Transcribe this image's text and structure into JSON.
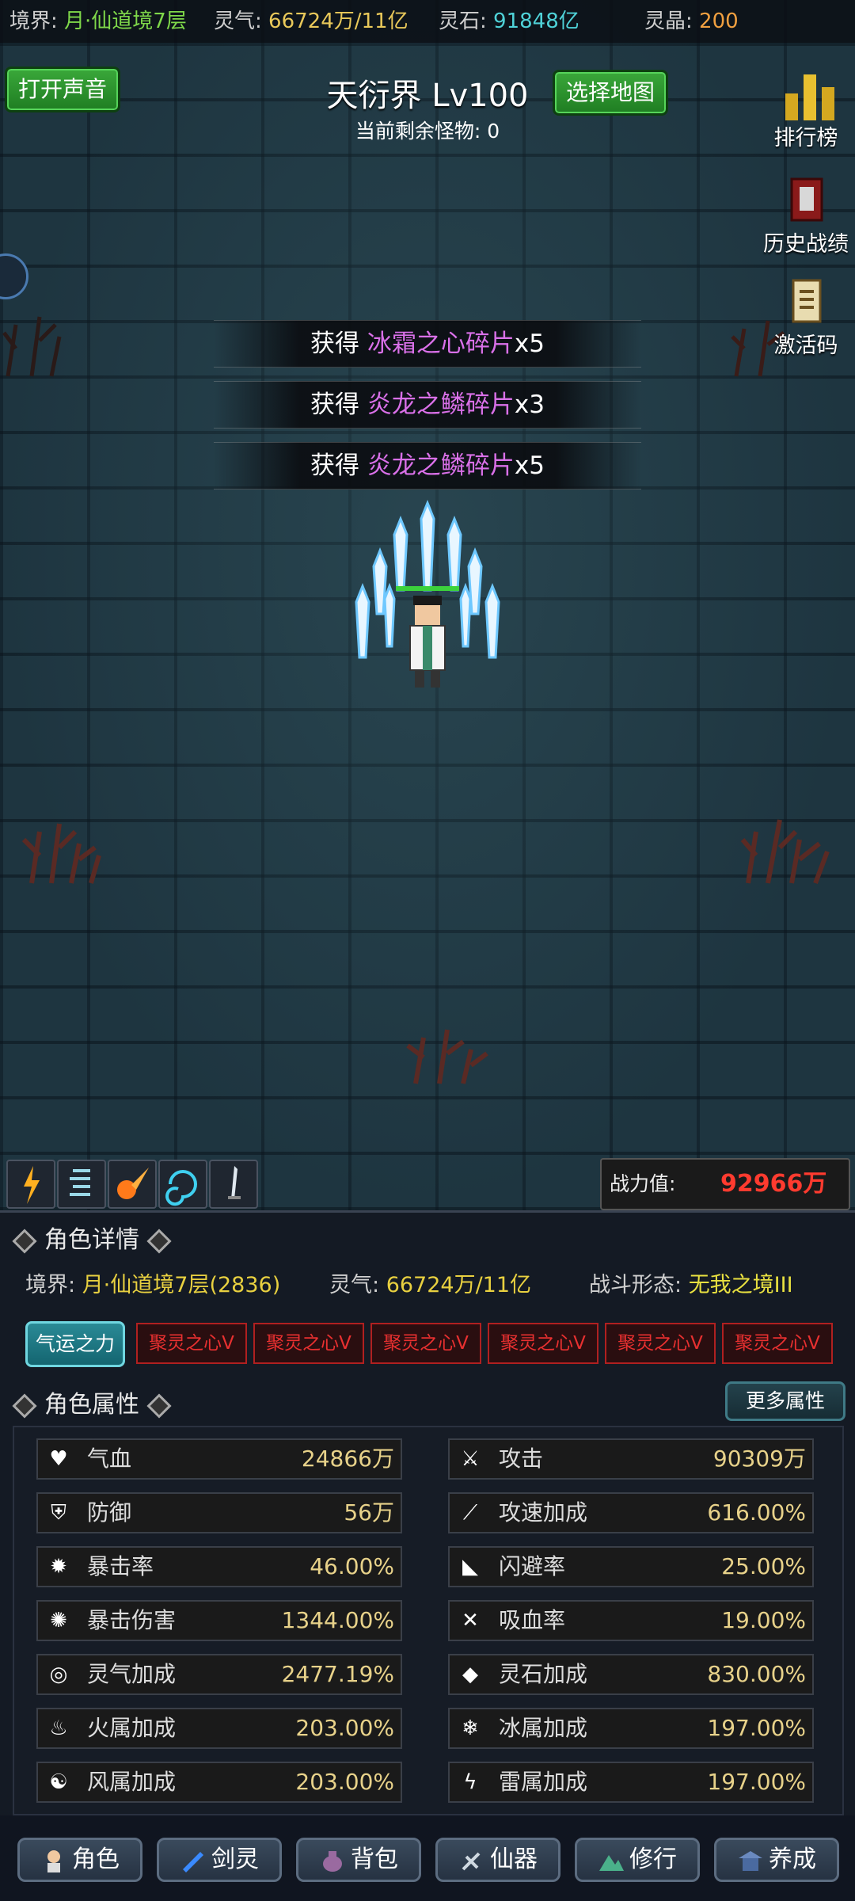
{
  "topbar": {
    "realm_label": "境界: ",
    "realm_value": "月·仙道境7层",
    "qi_label": "灵气: ",
    "qi_value": "66724万/11亿",
    "stone_label": "灵石: ",
    "stone_value": "91848亿",
    "crystal_label": "灵晶: ",
    "crystal_value": "200"
  },
  "controls": {
    "sound_button": "打开声音",
    "map_button": "选择地图"
  },
  "map": {
    "title": "天衍界 Lv100",
    "remaining_label": "当前剩余怪物: ",
    "remaining_value": "0"
  },
  "side_menu": [
    {
      "label": "排行榜",
      "icon": "bar-chart-icon"
    },
    {
      "label": "历史战绩",
      "icon": "book-icon"
    },
    {
      "label": "激活码",
      "icon": "scroll-icon"
    }
  ],
  "loot": [
    {
      "prefix": "获得 ",
      "item": "冰霜之心碎片",
      "qty": "x5"
    },
    {
      "prefix": "获得 ",
      "item": "炎龙之鳞碎片",
      "qty": "x3"
    },
    {
      "prefix": "获得 ",
      "item": "炎龙之鳞碎片",
      "qty": "x5"
    }
  ],
  "power": {
    "label": "战力值:",
    "value": "92966万"
  },
  "skills": [
    "lightning-skill-icon",
    "wind-skill-icon",
    "fireball-skill-icon",
    "vortex-skill-icon",
    "sword-skill-icon"
  ],
  "character": {
    "section_title": "角色详情",
    "realm_label": "境界: ",
    "realm_value": "月·仙道境7层(2836)",
    "qi_label": "灵气: ",
    "qi_value": "66724万/11亿",
    "form_label": "战斗形态: ",
    "form_value": "无我之境III",
    "luck_button": "气运之力",
    "hearts": [
      "聚灵之心V",
      "聚灵之心V",
      "聚灵之心V",
      "聚灵之心V",
      "聚灵之心V",
      "聚灵之心V"
    ]
  },
  "attributes": {
    "section_title": "角色属性",
    "more_button": "更多属性",
    "left": [
      {
        "name": "气血",
        "value": "24866万",
        "icon": "heart-icon"
      },
      {
        "name": "防御",
        "value": "56万",
        "icon": "armor-icon"
      },
      {
        "name": "暴击率",
        "value": "46.00%",
        "icon": "burst-icon"
      },
      {
        "name": "暴击伤害",
        "value": "1344.00%",
        "icon": "claw-icon"
      },
      {
        "name": "灵气加成",
        "value": "2477.19%",
        "icon": "swirl-icon"
      },
      {
        "name": "火属加成",
        "value": "203.00%",
        "icon": "fire-icon"
      },
      {
        "name": "风属加成",
        "value": "203.00%",
        "icon": "wind-icon"
      }
    ],
    "right": [
      {
        "name": "攻击",
        "value": "90309万",
        "icon": "sword-icon"
      },
      {
        "name": "攻速加成",
        "value": "616.00%",
        "icon": "slash-icon"
      },
      {
        "name": "闪避率",
        "value": "25.00%",
        "icon": "boot-icon"
      },
      {
        "name": "吸血率",
        "value": "19.00%",
        "icon": "fang-icon"
      },
      {
        "name": "灵石加成",
        "value": "830.00%",
        "icon": "crystal-icon"
      },
      {
        "name": "冰属加成",
        "value": "197.00%",
        "icon": "ice-icon"
      },
      {
        "name": "雷属加成",
        "value": "197.00%",
        "icon": "thunder-icon"
      }
    ]
  },
  "bottom_nav": [
    {
      "label": "角色",
      "icon": "character-icon"
    },
    {
      "label": "剑灵",
      "icon": "spirit-icon"
    },
    {
      "label": "背包",
      "icon": "bag-icon"
    },
    {
      "label": "仙器",
      "icon": "artifact-icon"
    },
    {
      "label": "修行",
      "icon": "mountain-icon"
    },
    {
      "label": "养成",
      "icon": "temple-icon"
    }
  ]
}
